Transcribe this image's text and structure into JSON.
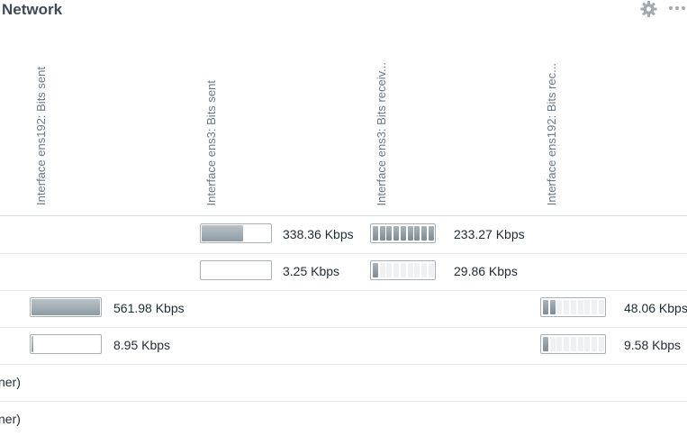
{
  "widget": {
    "title": "Network"
  },
  "icons": {
    "settings": "gear-icon",
    "more": "more-icon"
  },
  "columns": [
    "Interface ens192: Bits sent",
    "Interface ens3: Bits sent",
    "Interface ens3: Bits receiv...",
    "Interface ens192: Bits rec..."
  ],
  "rows": [
    {
      "ens3_sent": {
        "text": "338.36 Kbps",
        "level": 0.6
      },
      "ens3_received": {
        "text": "233.27 Kbps",
        "level": 1.0
      }
    },
    {
      "ens3_sent": {
        "text": "3.25 Kbps",
        "level": 0.0
      },
      "ens3_received": {
        "text": "29.86 Kbps",
        "level": 0.1
      }
    },
    {
      "ens192_sent": {
        "text": "561.98 Kbps",
        "level": 1.0
      },
      "ens192_received": {
        "text": "48.06 Kbps",
        "level": 0.2
      }
    },
    {
      "ens192_sent": {
        "text": "8.95 Kbps",
        "level": 0.02
      },
      "ens192_received": {
        "text": "9.58 Kbps",
        "level": 0.1
      }
    },
    {
      "label": "ner)"
    },
    {
      "label": "ner)"
    }
  ],
  "colors": {
    "title": "#3e4a5a",
    "header_text": "#6b7886",
    "bar_fill": "#8e9aa2",
    "border": "#a9b0b5"
  }
}
